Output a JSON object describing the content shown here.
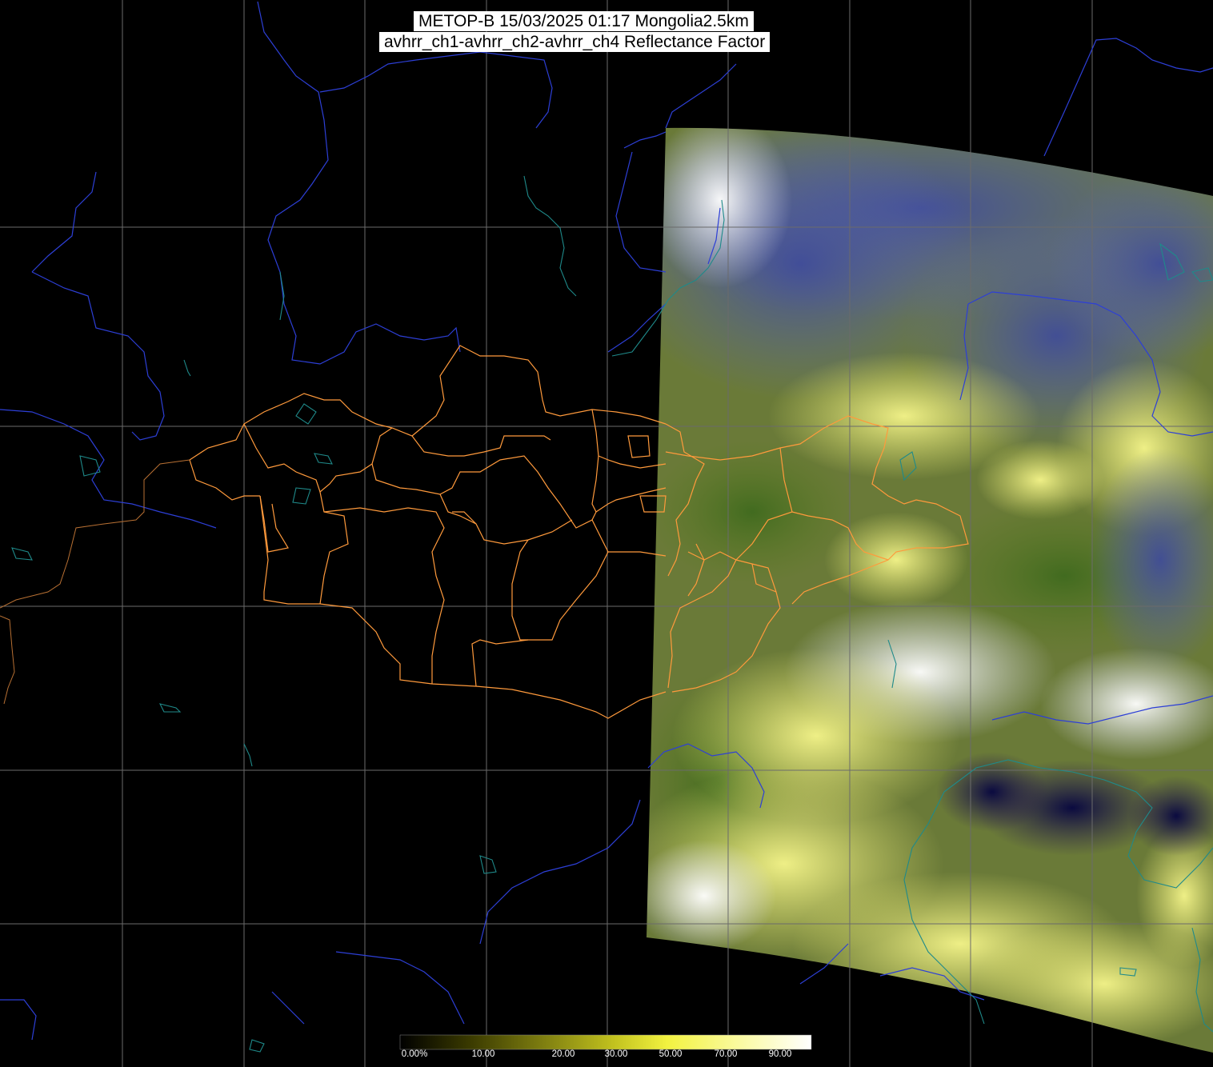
{
  "title": {
    "line1": "METOP-B 15/03/2025 01:17 Mongolia2.5km",
    "line2": "avhrr_ch1-avhrr_ch2-avhrr_ch4 Reflectance Factor"
  },
  "colorbar": {
    "ticks": [
      "0.00%",
      "10.00",
      "20.00",
      "30.00",
      "50.00",
      "70.00",
      "90.00"
    ],
    "stops": [
      "#000000",
      "#3a3a00",
      "#7f7f10",
      "#c2c21e",
      "#f2f240",
      "#fafa9e",
      "#ffffff"
    ]
  },
  "colors": {
    "background": "#000000",
    "graticule": "#6b6b6b",
    "river": "#2d3fd6",
    "coastline": "#1f8a8a",
    "admin_border": "#ff9a3c",
    "cloud_white": "#f2f2ff",
    "cloud_yellow": "#f0f07a",
    "land_green": "#5a7a20",
    "snow_blue": "#4a55a8"
  },
  "legend": {
    "swath": "satellite-swath",
    "borders": "admin-boundaries"
  }
}
